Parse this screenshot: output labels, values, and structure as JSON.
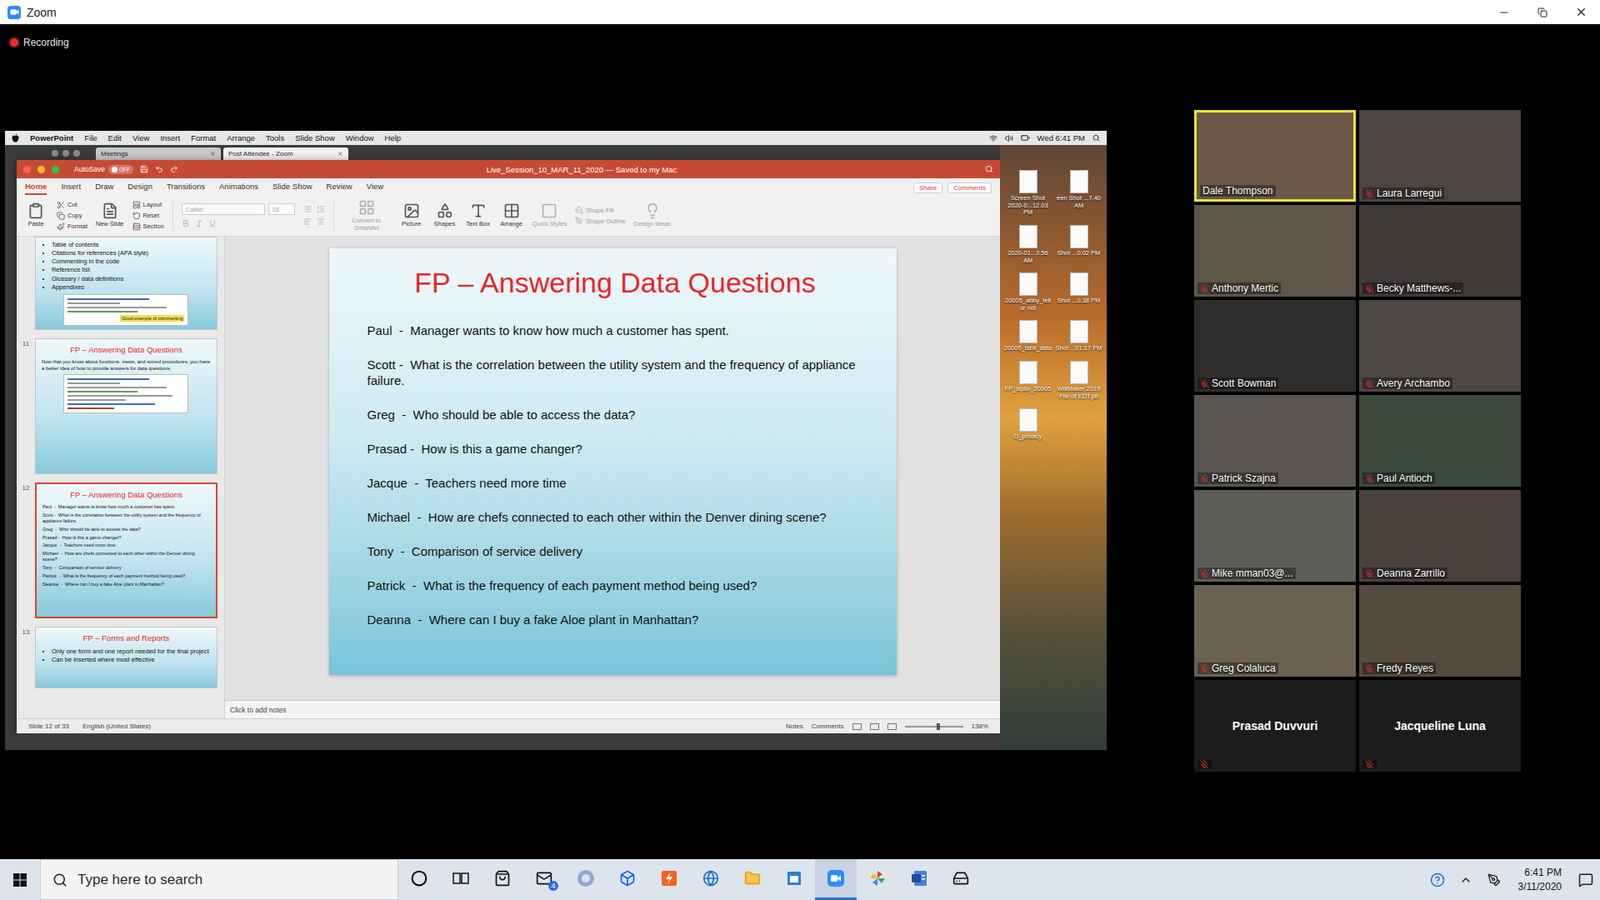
{
  "window": {
    "title": "Zoom"
  },
  "recording": {
    "label": "Recording",
    "on": true
  },
  "shared_screen": {
    "menu_bar": {
      "app": "PowerPoint",
      "items": [
        "File",
        "Edit",
        "View",
        "Insert",
        "Format",
        "Arrange",
        "Tools",
        "Slide Show",
        "Window",
        "Help"
      ],
      "clock": "Wed 6:41 PM"
    },
    "browser_tabs": [
      {
        "label": "Meetings",
        "selected": false
      },
      {
        "label": "Post Attendee - Zoom",
        "selected": true
      }
    ],
    "powerpoint": {
      "title": "Live_Session_10_MAR_11_2020 — Saved to my Mac",
      "autosave": {
        "label": "AutoSave",
        "value": "OFF",
        "on": false
      },
      "ribbon_tabs": [
        {
          "label": "Home",
          "selected": true
        },
        {
          "label": "Insert",
          "selected": false
        },
        {
          "label": "Draw",
          "selected": false
        },
        {
          "label": "Design",
          "selected": false
        },
        {
          "label": "Transitions",
          "selected": false
        },
        {
          "label": "Animations",
          "selected": false
        },
        {
          "label": "Slide Show",
          "selected": false
        },
        {
          "label": "Review",
          "selected": false
        },
        {
          "label": "View",
          "selected": false
        }
      ],
      "share": "Share",
      "comments": "Comments",
      "ribbon": [
        {
          "kind": "large",
          "label": "Paste",
          "disabled": false
        },
        {
          "kind": "stack",
          "items": [
            {
              "label": "Cut",
              "disabled": false
            },
            {
              "label": "Copy",
              "disabled": false
            },
            {
              "label": "Format",
              "disabled": false
            }
          ]
        },
        {
          "kind": "large",
          "label": "New Slide",
          "disabled": false
        },
        {
          "kind": "stack",
          "items": [
            {
              "label": "Layout",
              "disabled": false
            },
            {
              "label": "Reset",
              "disabled": false
            },
            {
              "label": "Section",
              "disabled": false
            }
          ]
        },
        {
          "kind": "font",
          "font": "Calibri",
          "size": "18",
          "disabled": true
        },
        {
          "kind": "paragraph",
          "disabled": true
        },
        {
          "kind": "large",
          "label": "Convert to SmartArt",
          "disabled": true
        },
        {
          "kind": "large",
          "label": "Picture",
          "disabled": false
        },
        {
          "kind": "large",
          "label": "Shapes",
          "disabled": false
        },
        {
          "kind": "large",
          "label": "Text Box",
          "disabled": false
        },
        {
          "kind": "large",
          "label": "Arrange",
          "disabled": false
        },
        {
          "kind": "large",
          "label": "Quick Styles",
          "disabled": true
        },
        {
          "kind": "stack",
          "items": [
            {
              "label": "Shape Fill",
              "disabled": true
            },
            {
              "label": "Shape Outline",
              "disabled": true
            }
          ]
        },
        {
          "kind": "large",
          "label": "Design Ideas",
          "disabled": true
        }
      ],
      "thumbnails": [
        {
          "kind": "bullets",
          "selected": false,
          "bullets": [
            "Table of contents",
            "Citations for references (APA style)",
            "Commenting in the code",
            "Reference list",
            "Glossary / data definitions",
            "Appendixes"
          ],
          "note": "Good example of commenting"
        },
        {
          "number": "11",
          "kind": "intro",
          "selected": false,
          "title": "FP – Answering Data Questions",
          "text": "Now that you know about functions, views, and stored procedures; you have a better idea of how to provide answers for data questions."
        },
        {
          "number": "12",
          "kind": "current",
          "selected": true
        },
        {
          "number": "13",
          "kind": "bullets",
          "selected": false,
          "title": "FP – Forms and Reports",
          "bullets": [
            "Only one form and one report needed for the final project",
            "Can be inserted where most effective"
          ]
        }
      ],
      "slide": {
        "title": "FP – Answering Data Questions",
        "entries": [
          "Paul  -  Manager wants to know how much a customer has spent.",
          "Scott -  What is the correlation between the utility system and the frequency of appliance failure.",
          "Greg  -  Who should be able to access the data?",
          "Prasad -  How is this a game changer?",
          "Jacque  -  Teachers need more time",
          "Michael  -  How are chefs connected to each other within the Denver dining scene?",
          "Tony  -  Comparison of service delivery",
          "Patrick  -  What is the frequency of each payment method being used?",
          "Deanna  -  Where can I buy a fake Aloe plant in Manhattan?"
        ]
      },
      "notes_placeholder": "Click to add notes",
      "status_bar": {
        "slide": "Slide 12 of 33",
        "language": "English (United States)",
        "notes": "Notes",
        "comments": "Comments",
        "zoom": "138%",
        "zoom_level": 0.55
      }
    },
    "desktop_icons": [
      {
        "label": "Screen Shot 2020-0...12.03 PM"
      },
      {
        "label": "een Shot ...7.40 AM"
      },
      {
        "label": "2020-01...3.56 AM"
      },
      {
        "label": "Shot ...0.02 PM"
      },
      {
        "label": "20005_abby_tell or not"
      },
      {
        "label": "Shot ...0.38 PM"
      },
      {
        "label": "20005_tabli_data"
      },
      {
        "label": "Shot ...01.17 PM"
      },
      {
        "label": "FP_siplin_20005"
      },
      {
        "label": "WillMaker 2019 File of EDT.pfl"
      },
      {
        "label": "D_privacy"
      }
    ]
  },
  "participants": [
    {
      "name": "Dale Thompson",
      "muted": false,
      "video": true,
      "speaking": true
    },
    {
      "name": "Laura Larregui",
      "muted": true,
      "video": true,
      "speaking": false
    },
    {
      "name": "Anthony Mertic",
      "muted": true,
      "video": true,
      "speaking": false
    },
    {
      "name": "Becky Matthews-...",
      "muted": true,
      "video": true,
      "speaking": false
    },
    {
      "name": "Scott Bowman",
      "muted": true,
      "video": true,
      "speaking": false
    },
    {
      "name": "Avery Archambo",
      "muted": true,
      "video": true,
      "speaking": false
    },
    {
      "name": "Patrick Szajna",
      "muted": true,
      "video": true,
      "speaking": false
    },
    {
      "name": "Paul Antioch",
      "muted": true,
      "video": true,
      "speaking": false
    },
    {
      "name": "Mike mman03@...",
      "muted": true,
      "video": true,
      "speaking": false
    },
    {
      "name": "Deanna Zarrillo",
      "muted": true,
      "video": true,
      "speaking": false
    },
    {
      "name": "Greg Colaluca",
      "muted": true,
      "video": true,
      "speaking": false
    },
    {
      "name": "Fredy Reyes",
      "muted": true,
      "video": true,
      "speaking": false
    },
    {
      "name": "Prasad Duvvuri",
      "muted": true,
      "video": false,
      "speaking": false
    },
    {
      "name": "Jacqueline Luna",
      "muted": true,
      "video": false,
      "speaking": false
    }
  ],
  "taskbar": {
    "search_placeholder": "Type here to search",
    "apps": [
      {
        "active": false
      },
      {
        "active": false
      },
      {
        "active": false
      },
      {
        "active": false,
        "badge": "4"
      },
      {
        "active": false
      },
      {
        "active": false
      },
      {
        "active": false
      },
      {
        "active": false
      },
      {
        "active": false
      },
      {
        "active": false
      },
      {
        "active": true
      },
      {
        "active": false
      },
      {
        "active": false
      },
      {
        "active": false
      }
    ],
    "time": "6:41 PM",
    "date": "3/11/2020"
  }
}
